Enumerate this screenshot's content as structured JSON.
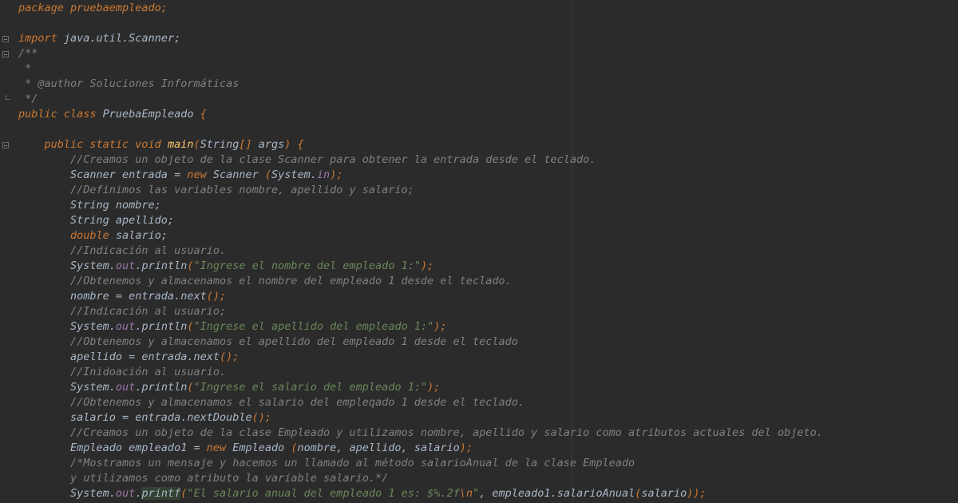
{
  "editor": {
    "lines": [
      [
        {
          "t": "package pruebaempleado;",
          "c": "kw"
        }
      ],
      [],
      [
        {
          "t": "import ",
          "c": "kw"
        },
        {
          "t": "java.util.Scanner;",
          "c": "tx"
        }
      ],
      [
        {
          "t": "/**",
          "c": "cmt"
        }
      ],
      [
        {
          "t": " *",
          "c": "cmt"
        }
      ],
      [
        {
          "t": " * @author Soluciones Informáticas",
          "c": "cmt"
        }
      ],
      [
        {
          "t": " */",
          "c": "cmt"
        }
      ],
      [
        {
          "t": "public class ",
          "c": "kw"
        },
        {
          "t": "PruebaEmpleado ",
          "c": "tx"
        },
        {
          "t": "{",
          "c": "par"
        }
      ],
      [],
      [
        {
          "t": "    public static void ",
          "c": "kw"
        },
        {
          "t": "main",
          "c": "fn"
        },
        {
          "t": "(",
          "c": "par"
        },
        {
          "t": "String",
          "c": "tx"
        },
        {
          "t": "[] ",
          "c": "par"
        },
        {
          "t": "args",
          "c": "tx"
        },
        {
          "t": ") {",
          "c": "par"
        }
      ],
      [
        {
          "t": "        //Creamos un objeto de la clase Scanner para obtener la entrada desde el teclado.",
          "c": "cmt"
        }
      ],
      [
        {
          "t": "        Scanner entrada = ",
          "c": "tx"
        },
        {
          "t": "new ",
          "c": "kw"
        },
        {
          "t": "Scanner ",
          "c": "tx"
        },
        {
          "t": "(",
          "c": "par"
        },
        {
          "t": "System.",
          "c": "tx"
        },
        {
          "t": "in",
          "c": "fld"
        },
        {
          "t": ");",
          "c": "par"
        }
      ],
      [
        {
          "t": "        //Definimos las variables nombre, apellido y salario;",
          "c": "cmt"
        }
      ],
      [
        {
          "t": "        String nombre;",
          "c": "tx"
        }
      ],
      [
        {
          "t": "        String apellido;",
          "c": "tx"
        }
      ],
      [
        {
          "t": "        ",
          "c": "tx"
        },
        {
          "t": "double ",
          "c": "kw"
        },
        {
          "t": "salario;",
          "c": "tx"
        }
      ],
      [
        {
          "t": "        //Indicación al usuario.",
          "c": "cmt"
        }
      ],
      [
        {
          "t": "        System.",
          "c": "tx"
        },
        {
          "t": "out",
          "c": "fld"
        },
        {
          "t": ".println",
          "c": "tx"
        },
        {
          "t": "(",
          "c": "par"
        },
        {
          "t": "\"Ingrese el nombre del empleado 1:\"",
          "c": "str"
        },
        {
          "t": ");",
          "c": "par"
        }
      ],
      [
        {
          "t": "        //Obtenemos y almacenamos el nombre del empleado 1 desde el teclado.",
          "c": "cmt"
        }
      ],
      [
        {
          "t": "        nombre = entrada.next",
          "c": "tx"
        },
        {
          "t": "();",
          "c": "par"
        }
      ],
      [
        {
          "t": "        //Indicación al usuario;",
          "c": "cmt"
        }
      ],
      [
        {
          "t": "        System.",
          "c": "tx"
        },
        {
          "t": "out",
          "c": "fld"
        },
        {
          "t": ".println",
          "c": "tx"
        },
        {
          "t": "(",
          "c": "par"
        },
        {
          "t": "\"Ingrese el apellido del empleado 1:\"",
          "c": "str"
        },
        {
          "t": ");",
          "c": "par"
        }
      ],
      [
        {
          "t": "        //Obtenemos y almacenamos el apellido del empleado 1 desde el teclado",
          "c": "cmt"
        }
      ],
      [
        {
          "t": "        apellido = entrada.next",
          "c": "tx"
        },
        {
          "t": "();",
          "c": "par"
        }
      ],
      [
        {
          "t": "        //Inidoación al usuario.",
          "c": "cmt"
        }
      ],
      [
        {
          "t": "        System.",
          "c": "tx"
        },
        {
          "t": "out",
          "c": "fld"
        },
        {
          "t": ".println",
          "c": "tx"
        },
        {
          "t": "(",
          "c": "par"
        },
        {
          "t": "\"Ingrese el salario del empleado 1:\"",
          "c": "str"
        },
        {
          "t": ");",
          "c": "par"
        }
      ],
      [
        {
          "t": "        //Obtenemos y almacenamos el salario del empleqado 1 desde el teclado.",
          "c": "cmt"
        }
      ],
      [
        {
          "t": "        salario = entrada.nextDouble",
          "c": "tx"
        },
        {
          "t": "();",
          "c": "par"
        }
      ],
      [
        {
          "t": "        //Creamos un objeto de la clase Empleado y utilizamos nombre, apellido y salario como atributos actuales del objeto.",
          "c": "cmt"
        }
      ],
      [
        {
          "t": "        Empleado empleado1 = ",
          "c": "tx"
        },
        {
          "t": "new ",
          "c": "kw"
        },
        {
          "t": "Empleado ",
          "c": "tx"
        },
        {
          "t": "(",
          "c": "par"
        },
        {
          "t": "nombre, apellido, salario",
          "c": "tx"
        },
        {
          "t": ");",
          "c": "par"
        }
      ],
      [
        {
          "t": "        /*Mostramos un mensaje y hacemos un llamado al método salarioAnual de la clase Empleado",
          "c": "cmt"
        }
      ],
      [
        {
          "t": "        y utilizamos como atributo la variable salario.*/",
          "c": "cmt"
        }
      ],
      [
        {
          "t": "        System.",
          "c": "tx"
        },
        {
          "t": "out",
          "c": "fld"
        },
        {
          "t": ".",
          "c": "tx"
        },
        {
          "t": "printf",
          "c": "hl tx"
        },
        {
          "t": "(",
          "c": "par"
        },
        {
          "t": "\"El salario anual del empleado 1 es: $%.2f",
          "c": "str"
        },
        {
          "t": "\\n",
          "c": "esc"
        },
        {
          "t": "\"",
          "c": "str"
        },
        {
          "t": ", empleado1.salarioAnual",
          "c": "tx"
        },
        {
          "t": "(",
          "c": "par"
        },
        {
          "t": "salario",
          "c": "tx"
        },
        {
          "t": "));",
          "c": "par"
        }
      ]
    ],
    "folds": [
      2,
      3,
      9
    ],
    "fold_ends": [
      6
    ]
  }
}
